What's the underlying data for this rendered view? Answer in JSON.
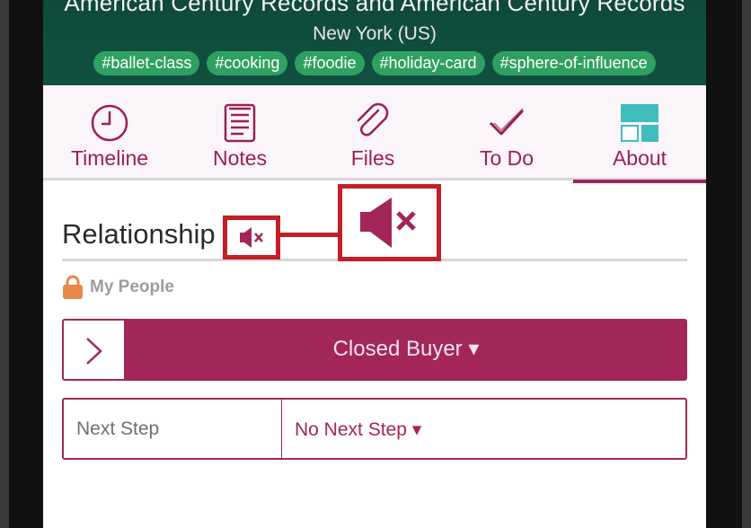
{
  "header": {
    "title": "American Century Records and American Century Records",
    "location": "New York (US)",
    "tags": [
      "#ballet-class",
      "#cooking",
      "#foodie",
      "#holiday-card",
      "#sphere-of-influence"
    ]
  },
  "tabs": [
    {
      "label": "Timeline",
      "icon": "clock-icon"
    },
    {
      "label": "Notes",
      "icon": "notes-icon"
    },
    {
      "label": "Files",
      "icon": "paperclip-icon"
    },
    {
      "label": "To Do",
      "icon": "checkmark-icon"
    },
    {
      "label": "About",
      "icon": "about-layout-icon",
      "active": true
    }
  ],
  "relationship": {
    "title": "Relationship",
    "visibility": "My People",
    "stage": "Closed Buyer ▾",
    "next_step_label": "Next Step",
    "next_step_value": "No Next Step ▾"
  },
  "colors": {
    "brand": "#a3265a",
    "header_bg": "#0f4a3c",
    "tag_bg": "#2ea160",
    "annotation": "#c41f27"
  }
}
